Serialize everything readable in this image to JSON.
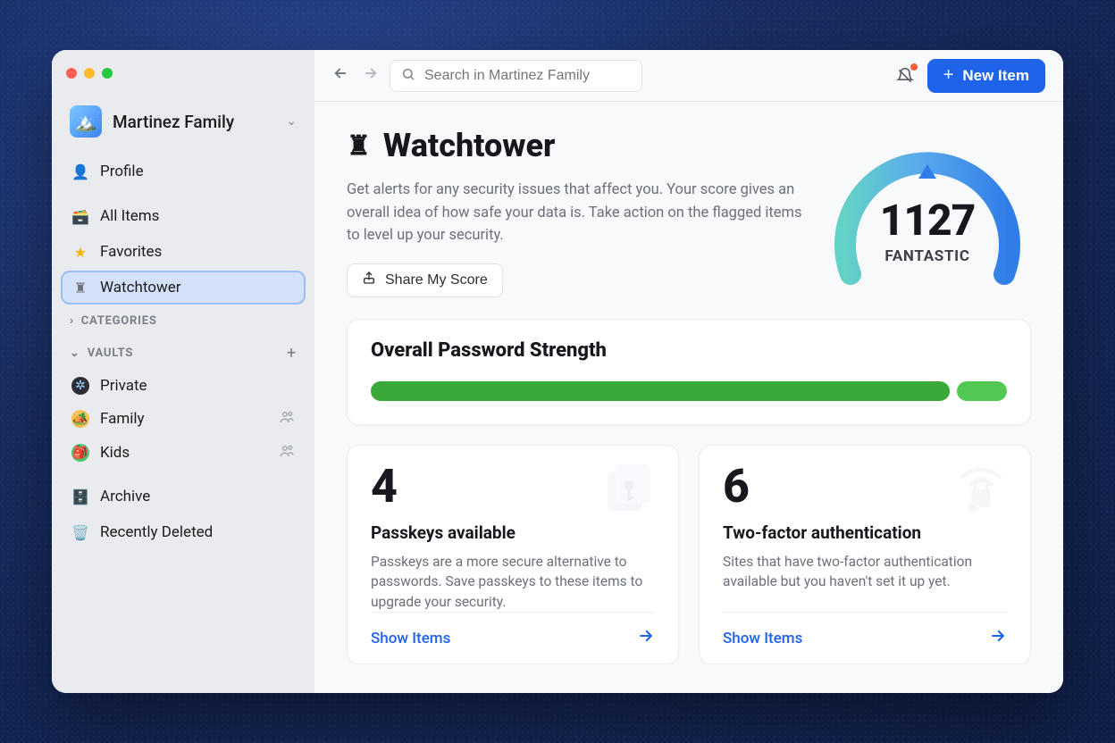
{
  "account": {
    "name": "Martinez Family"
  },
  "sidebar": {
    "profile": "Profile",
    "all_items": "All Items",
    "favorites": "Favorites",
    "watchtower": "Watchtower",
    "categories_header": "CATEGORIES",
    "vaults_header": "VAULTS",
    "vaults": {
      "private": "Private",
      "family": "Family",
      "kids": "Kids"
    },
    "archive": "Archive",
    "recently_deleted": "Recently Deleted"
  },
  "topbar": {
    "search_placeholder": "Search in Martinez Family",
    "new_item": "New Item"
  },
  "hero": {
    "title": "Watchtower",
    "description": "Get alerts for any security issues that affect you. Your score gives an overall idea of how safe your data is. Take action on the flagged items to level up your security.",
    "share_label": "Share My Score",
    "score": "1127",
    "score_label": "FANTASTIC"
  },
  "strength": {
    "title": "Overall Password Strength",
    "segments": [
      {
        "color": "#3aa93a",
        "flex": 92
      },
      {
        "color": "#52c752",
        "flex": 8
      }
    ]
  },
  "tiles": {
    "passkeys": {
      "count": "4",
      "title": "Passkeys available",
      "desc": "Passkeys are a more secure alternative to passwords. Save passkeys to these items to upgrade your security.",
      "action": "Show Items"
    },
    "twofa": {
      "count": "6",
      "title": "Two-factor authentication",
      "desc": "Sites that have two-factor authentication available but you haven't set it up yet.",
      "action": "Show Items"
    }
  }
}
